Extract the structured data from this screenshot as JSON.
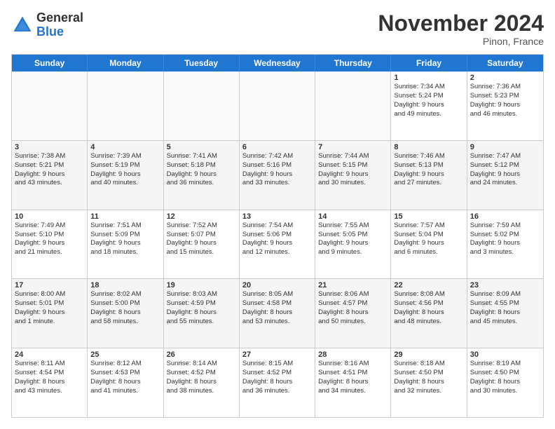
{
  "header": {
    "logo_line1": "General",
    "logo_line2": "Blue",
    "month_title": "November 2024",
    "location": "Pinon, France"
  },
  "weekdays": [
    "Sunday",
    "Monday",
    "Tuesday",
    "Wednesday",
    "Thursday",
    "Friday",
    "Saturday"
  ],
  "weeks": [
    [
      {
        "day": "",
        "info": ""
      },
      {
        "day": "",
        "info": ""
      },
      {
        "day": "",
        "info": ""
      },
      {
        "day": "",
        "info": ""
      },
      {
        "day": "",
        "info": ""
      },
      {
        "day": "1",
        "info": "Sunrise: 7:34 AM\nSunset: 5:24 PM\nDaylight: 9 hours\nand 49 minutes."
      },
      {
        "day": "2",
        "info": "Sunrise: 7:36 AM\nSunset: 5:23 PM\nDaylight: 9 hours\nand 46 minutes."
      }
    ],
    [
      {
        "day": "3",
        "info": "Sunrise: 7:38 AM\nSunset: 5:21 PM\nDaylight: 9 hours\nand 43 minutes."
      },
      {
        "day": "4",
        "info": "Sunrise: 7:39 AM\nSunset: 5:19 PM\nDaylight: 9 hours\nand 40 minutes."
      },
      {
        "day": "5",
        "info": "Sunrise: 7:41 AM\nSunset: 5:18 PM\nDaylight: 9 hours\nand 36 minutes."
      },
      {
        "day": "6",
        "info": "Sunrise: 7:42 AM\nSunset: 5:16 PM\nDaylight: 9 hours\nand 33 minutes."
      },
      {
        "day": "7",
        "info": "Sunrise: 7:44 AM\nSunset: 5:15 PM\nDaylight: 9 hours\nand 30 minutes."
      },
      {
        "day": "8",
        "info": "Sunrise: 7:46 AM\nSunset: 5:13 PM\nDaylight: 9 hours\nand 27 minutes."
      },
      {
        "day": "9",
        "info": "Sunrise: 7:47 AM\nSunset: 5:12 PM\nDaylight: 9 hours\nand 24 minutes."
      }
    ],
    [
      {
        "day": "10",
        "info": "Sunrise: 7:49 AM\nSunset: 5:10 PM\nDaylight: 9 hours\nand 21 minutes."
      },
      {
        "day": "11",
        "info": "Sunrise: 7:51 AM\nSunset: 5:09 PM\nDaylight: 9 hours\nand 18 minutes."
      },
      {
        "day": "12",
        "info": "Sunrise: 7:52 AM\nSunset: 5:07 PM\nDaylight: 9 hours\nand 15 minutes."
      },
      {
        "day": "13",
        "info": "Sunrise: 7:54 AM\nSunset: 5:06 PM\nDaylight: 9 hours\nand 12 minutes."
      },
      {
        "day": "14",
        "info": "Sunrise: 7:55 AM\nSunset: 5:05 PM\nDaylight: 9 hours\nand 9 minutes."
      },
      {
        "day": "15",
        "info": "Sunrise: 7:57 AM\nSunset: 5:04 PM\nDaylight: 9 hours\nand 6 minutes."
      },
      {
        "day": "16",
        "info": "Sunrise: 7:59 AM\nSunset: 5:02 PM\nDaylight: 9 hours\nand 3 minutes."
      }
    ],
    [
      {
        "day": "17",
        "info": "Sunrise: 8:00 AM\nSunset: 5:01 PM\nDaylight: 9 hours\nand 1 minute."
      },
      {
        "day": "18",
        "info": "Sunrise: 8:02 AM\nSunset: 5:00 PM\nDaylight: 8 hours\nand 58 minutes."
      },
      {
        "day": "19",
        "info": "Sunrise: 8:03 AM\nSunset: 4:59 PM\nDaylight: 8 hours\nand 55 minutes."
      },
      {
        "day": "20",
        "info": "Sunrise: 8:05 AM\nSunset: 4:58 PM\nDaylight: 8 hours\nand 53 minutes."
      },
      {
        "day": "21",
        "info": "Sunrise: 8:06 AM\nSunset: 4:57 PM\nDaylight: 8 hours\nand 50 minutes."
      },
      {
        "day": "22",
        "info": "Sunrise: 8:08 AM\nSunset: 4:56 PM\nDaylight: 8 hours\nand 48 minutes."
      },
      {
        "day": "23",
        "info": "Sunrise: 8:09 AM\nSunset: 4:55 PM\nDaylight: 8 hours\nand 45 minutes."
      }
    ],
    [
      {
        "day": "24",
        "info": "Sunrise: 8:11 AM\nSunset: 4:54 PM\nDaylight: 8 hours\nand 43 minutes."
      },
      {
        "day": "25",
        "info": "Sunrise: 8:12 AM\nSunset: 4:53 PM\nDaylight: 8 hours\nand 41 minutes."
      },
      {
        "day": "26",
        "info": "Sunrise: 8:14 AM\nSunset: 4:52 PM\nDaylight: 8 hours\nand 38 minutes."
      },
      {
        "day": "27",
        "info": "Sunrise: 8:15 AM\nSunset: 4:52 PM\nDaylight: 8 hours\nand 36 minutes."
      },
      {
        "day": "28",
        "info": "Sunrise: 8:16 AM\nSunset: 4:51 PM\nDaylight: 8 hours\nand 34 minutes."
      },
      {
        "day": "29",
        "info": "Sunrise: 8:18 AM\nSunset: 4:50 PM\nDaylight: 8 hours\nand 32 minutes."
      },
      {
        "day": "30",
        "info": "Sunrise: 8:19 AM\nSunset: 4:50 PM\nDaylight: 8 hours\nand 30 minutes."
      }
    ]
  ]
}
